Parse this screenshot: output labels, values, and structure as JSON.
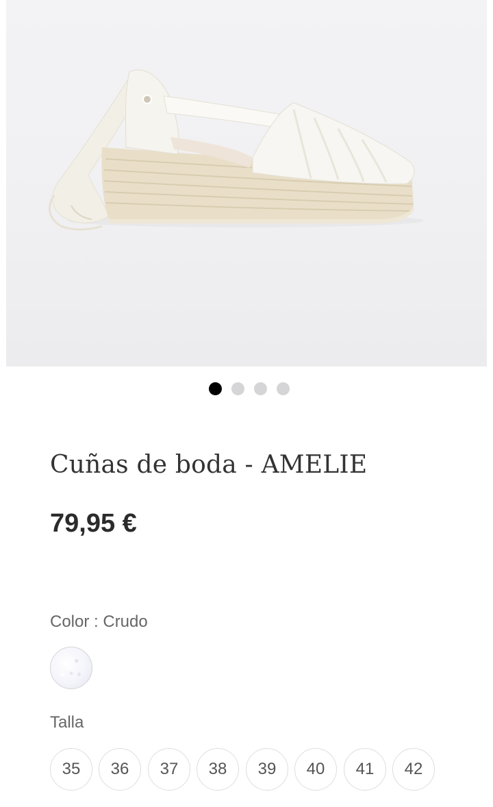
{
  "product": {
    "image_icon": "espadrille-wedge-shoe-photo",
    "title": "Cuñas de boda - AMELIE",
    "price": "79,95 €"
  },
  "carousel": {
    "slide_count": 4,
    "active_index": 0
  },
  "color": {
    "label": "Color : Crudo",
    "swatch_color": "#f4f4fb"
  },
  "size": {
    "label": "Talla",
    "options": [
      "35",
      "36",
      "37",
      "38",
      "39",
      "40",
      "41",
      "42"
    ]
  },
  "colors": {
    "dot_active": "#000000",
    "dot_inactive": "#d5d5d7",
    "text_primary": "#333333",
    "text_secondary": "#666666"
  }
}
